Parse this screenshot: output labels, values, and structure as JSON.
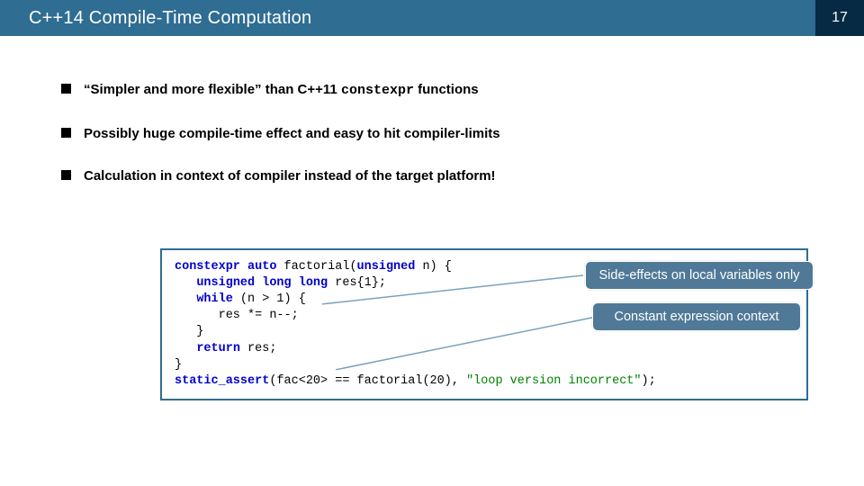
{
  "header": {
    "title": "C++14 Compile-Time Computation",
    "page": "17"
  },
  "bullets": [
    {
      "pre": "“Simpler and more flexible” than C++11 ",
      "mono": "constexpr",
      "post": " functions"
    },
    {
      "pre": "Possibly huge compile-time effect and easy to hit compiler-limits",
      "mono": "",
      "post": ""
    },
    {
      "pre": "Calculation in context of compiler instead of the target platform!",
      "mono": "",
      "post": ""
    }
  ],
  "code": {
    "l1a": "constexpr auto ",
    "l1b": "factorial(",
    "l1c": "unsigned",
    "l1d": " n) {",
    "l2a": "   ",
    "l2b": "unsigned long long",
    "l2c": " res{1};",
    "l3a": "   ",
    "l3b": "while",
    "l3c": " (n > 1) {",
    "l4": "      res *= n--;",
    "l5": "   }",
    "l6a": "   ",
    "l6b": "return",
    "l6c": " res;",
    "l7": "}",
    "l8a": "static_assert",
    "l8b": "(fac<20> == factorial(20), ",
    "l8c": "\"loop version incorrect\"",
    "l8d": ");"
  },
  "callouts": {
    "c1": "Side-effects on local variables only",
    "c2": "Constant expression context"
  }
}
